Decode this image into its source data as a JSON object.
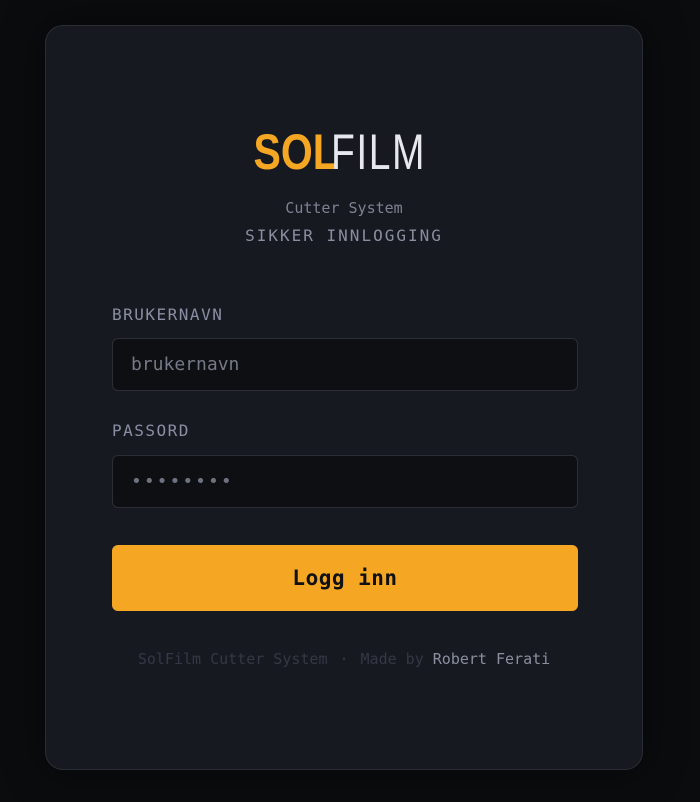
{
  "brand": {
    "logo_part1": "SOL",
    "logo_part2": "FILM",
    "subtitle": "Cutter System",
    "tagline": "SIKKER INNLOGGING"
  },
  "form": {
    "username_label": "BRUKERNAVN",
    "username_placeholder": "brukernavn",
    "username_value": "",
    "password_label": "PASSORD",
    "password_placeholder": "••••••••",
    "password_value": "",
    "submit_label": "Logg inn"
  },
  "footer": {
    "product": "SolFilm Cutter System",
    "separator": "·",
    "made_by": "Made by",
    "author": "Robert Ferati"
  },
  "colors": {
    "accent": "#f5a623",
    "background": "#0b0c0e",
    "card": "#171920"
  }
}
